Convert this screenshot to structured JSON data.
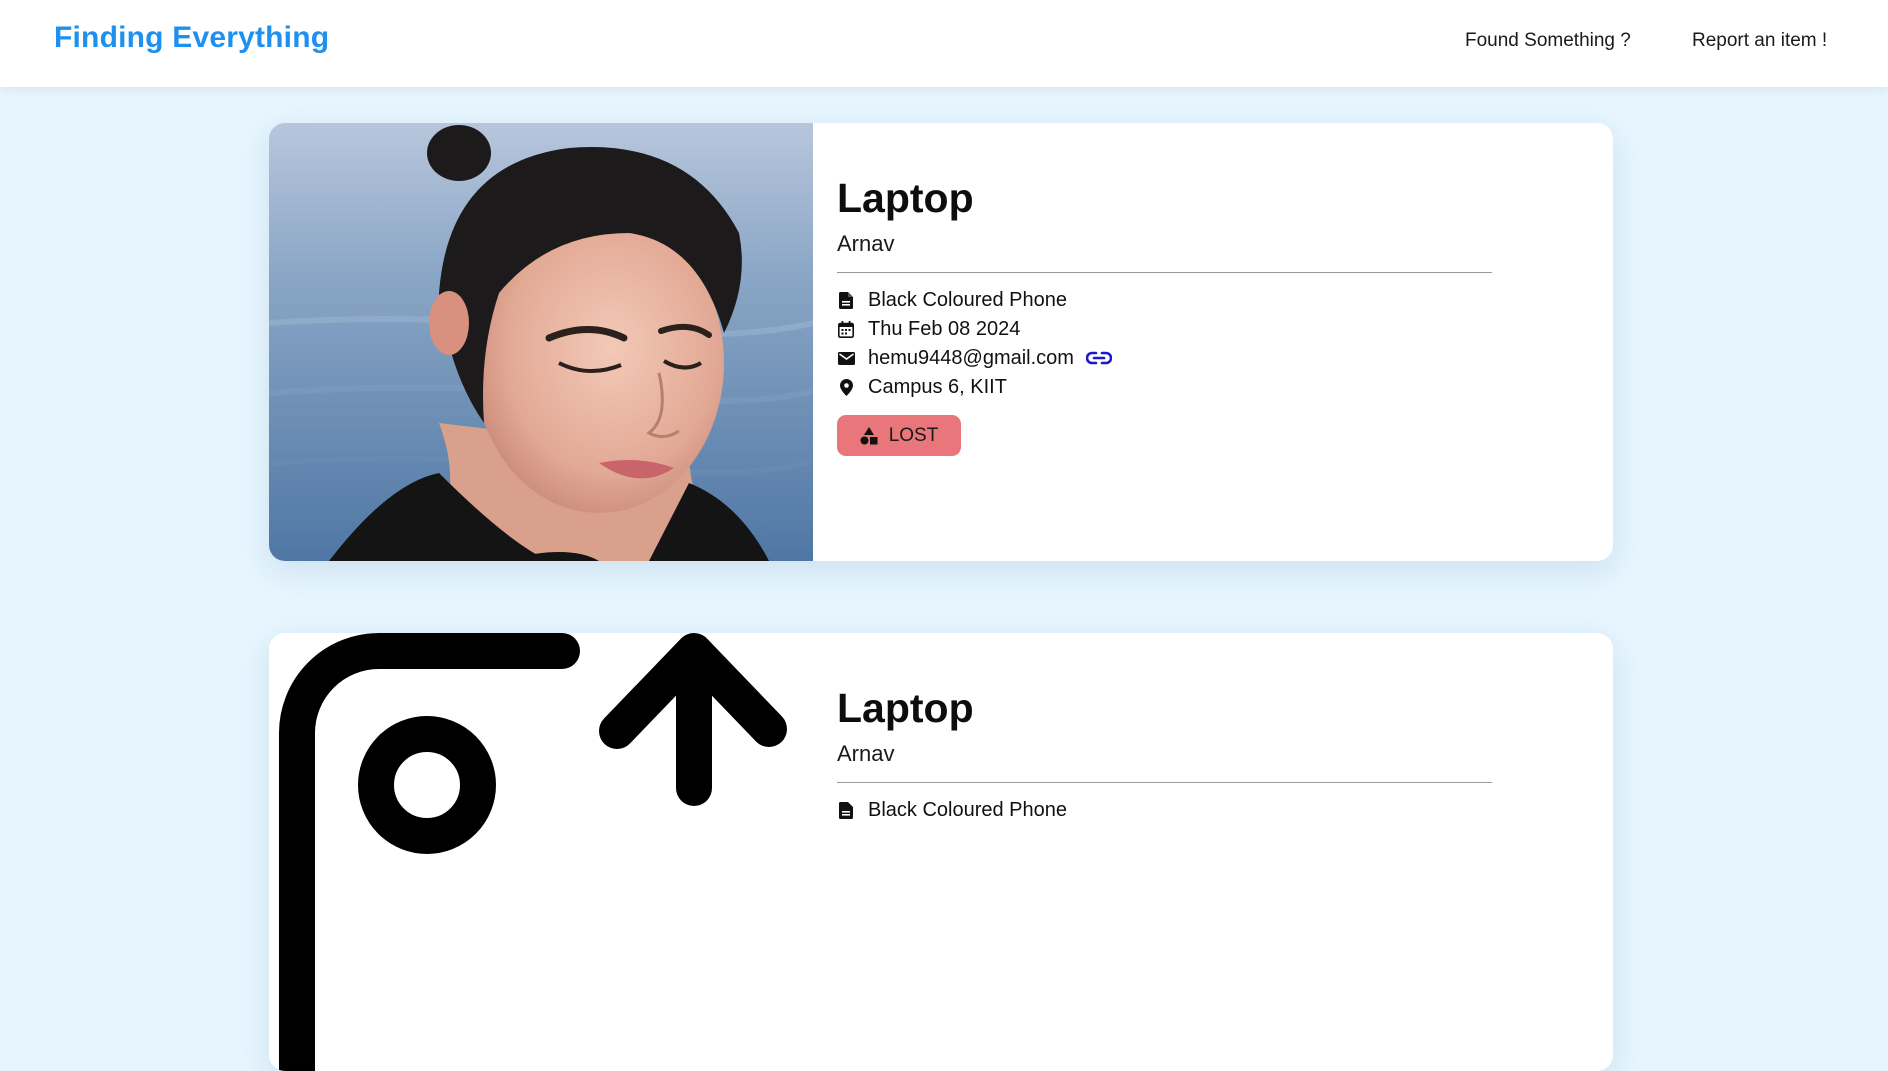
{
  "navbar": {
    "brand": "Finding Everything",
    "links": [
      "Found Something ?",
      "Report an item !"
    ]
  },
  "cards": [
    {
      "image": "portrait-photo",
      "title": "Laptop",
      "owner": "Arnav",
      "description": "Black Coloured Phone",
      "date": "Thu Feb 08 2024",
      "email": "hemu9448@gmail.com",
      "location": "Campus 6, KIIT",
      "status": "LOST",
      "status_color": "#e8767a"
    },
    {
      "image": "upload-placeholder-icon",
      "title": "Laptop",
      "owner": "Arnav",
      "description": "Black Coloured Phone"
    }
  ],
  "icons": {
    "description": "document-icon",
    "date": "calendar-icon",
    "email": "mail-icon",
    "location": "location-pin-icon",
    "email_link": "link-icon",
    "status": "shapes-icon"
  },
  "colors": {
    "brand": "#1e90ef",
    "background": "#e6f5fe",
    "link_icon": "#1a1acc"
  }
}
